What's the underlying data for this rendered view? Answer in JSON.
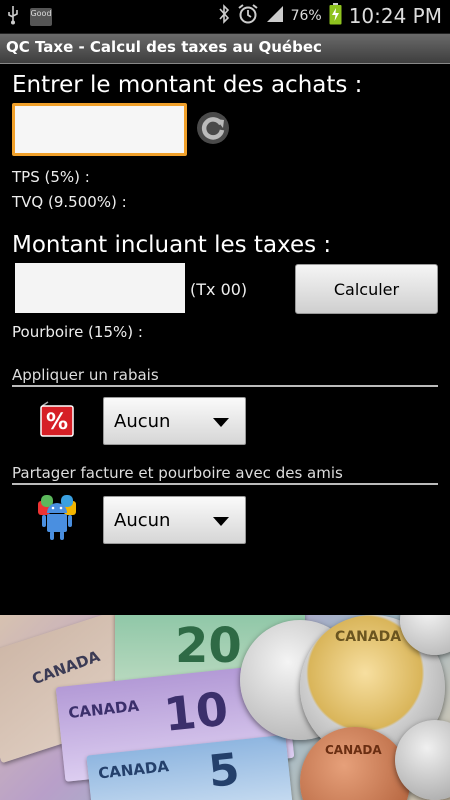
{
  "status_bar": {
    "notification_label": "Good",
    "battery_percent": "76%",
    "time": "10:24 PM",
    "icons": [
      "usb-icon",
      "good-notification-icon",
      "bluetooth-icon",
      "alarm-icon",
      "signal-icon",
      "battery-charging-icon"
    ]
  },
  "title_bar": {
    "title": "QC Taxe - Calcul des taxes au Québec"
  },
  "purchase": {
    "label": "Entrer le montant des achats :",
    "input_value": "",
    "tps_label": "TPS (5%) :",
    "tvq_label": "TVQ (9.500%) :"
  },
  "total": {
    "label": "Montant incluant les taxes :",
    "input_value": "",
    "tx_label": "(Tx 00)",
    "calc_button": "Calculer",
    "tip_label": "Pourboire (15%) :"
  },
  "discount": {
    "section_label": "Appliquer un rabais",
    "icon": "percent-tag-icon",
    "icon_text": "%",
    "selected": "Aucun"
  },
  "share": {
    "section_label": "Partager facture et pourboire avec des amis",
    "icon": "android-friends-icon",
    "selected": "Aucun"
  },
  "banner": {
    "bill_texts": [
      "CANADA",
      "CANADA",
      "CANADA"
    ],
    "denominations": [
      "20",
      "10",
      "5"
    ],
    "coin_texts": [
      "CANADA",
      "CANADA"
    ]
  },
  "colors": {
    "accent_focus": "#f0a02a",
    "background": "#000000",
    "title_bar": "#555555"
  }
}
